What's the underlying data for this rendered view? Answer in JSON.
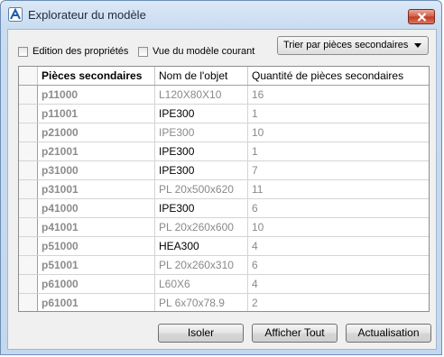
{
  "window": {
    "title": "Explorateur du modèle"
  },
  "options": {
    "edit_properties": "Edition des propriétés",
    "current_view": "Vue du modèle courant",
    "sort_selected": "Trier par pièces secondaires"
  },
  "table": {
    "columns": [
      "Pièces secondaires",
      "Nom de l'objet",
      "Quantité de pièces secondaires"
    ],
    "rows": [
      {
        "ref": "p11000",
        "name": "L120X80X10",
        "qty": "16",
        "active": false
      },
      {
        "ref": "p11001",
        "name": "IPE300",
        "qty": "1",
        "active": true
      },
      {
        "ref": "p21000",
        "name": "IPE300",
        "qty": "10",
        "active": false
      },
      {
        "ref": "p21001",
        "name": "IPE300",
        "qty": "1",
        "active": true
      },
      {
        "ref": "p31000",
        "name": "IPE300",
        "qty": "7",
        "active": true
      },
      {
        "ref": "p31001",
        "name": "PL 20x500x620",
        "qty": "11",
        "active": false
      },
      {
        "ref": "p41000",
        "name": "IPE300",
        "qty": "6",
        "active": true
      },
      {
        "ref": "p41001",
        "name": "PL 20x260x600",
        "qty": "10",
        "active": false
      },
      {
        "ref": "p51000",
        "name": "HEA300",
        "qty": "4",
        "active": true
      },
      {
        "ref": "p51001",
        "name": "PL 20x260x310",
        "qty": "6",
        "active": false
      },
      {
        "ref": "p61000",
        "name": "L60X6",
        "qty": "4",
        "active": false
      },
      {
        "ref": "p61001",
        "name": "PL 6x70x78.9",
        "qty": "2",
        "active": false
      }
    ]
  },
  "buttons": {
    "isolate": "Isoler",
    "show_all": "Afficher Tout",
    "refresh": "Actualisation"
  }
}
